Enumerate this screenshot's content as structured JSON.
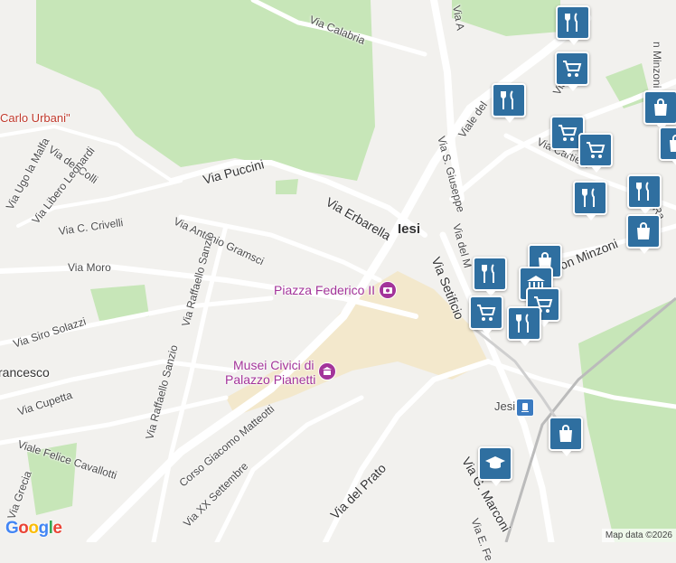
{
  "map": {
    "streets": [
      {
        "id": "via-calabria",
        "text": "Via Calabria"
      },
      {
        "id": "via-s-giuseppe",
        "text": "Via S. Giuseppe"
      },
      {
        "id": "viale-del",
        "text": "Viale del"
      },
      {
        "id": "via-dei-colli",
        "text": "Via dei Colli"
      },
      {
        "id": "via-ugo-la-malfa",
        "text": "Via Ugo la Malfa"
      },
      {
        "id": "via-libero-leonardi",
        "text": "Via Libero Leonardi"
      },
      {
        "id": "via-c-crivelli",
        "text": "Via C. Crivelli"
      },
      {
        "id": "via-puccini",
        "text": "Via Puccini"
      },
      {
        "id": "via-erbarella",
        "text": "Via Erbarella"
      },
      {
        "id": "via-antonio-gramsci",
        "text": "Via Antonio Gramsci"
      },
      {
        "id": "via-raffaello-sanzio-1",
        "text": "Via Raffaello Sanzio"
      },
      {
        "id": "via-moro",
        "text": "Via Moro"
      },
      {
        "id": "via-siro-solazzi",
        "text": "Via Siro Solazzi"
      },
      {
        "id": "francesco",
        "text": "rancesco"
      },
      {
        "id": "via-cupetta",
        "text": "Via Cupetta"
      },
      {
        "id": "via-raffaello-sanzio-2",
        "text": "Via Raffaello Sanzio"
      },
      {
        "id": "viale-felice-cavallotti",
        "text": "Viale Felice Cavallotti"
      },
      {
        "id": "via-grecia",
        "text": "Via Grecia"
      },
      {
        "id": "corso-giacomo-matteotti",
        "text": "Corso Giacomo Matteotti"
      },
      {
        "id": "via-xx-settembre",
        "text": "Via XX Settembre"
      },
      {
        "id": "via-del-prato",
        "text": "Via del Prato"
      },
      {
        "id": "via-setificio",
        "text": "Via Setificio"
      },
      {
        "id": "via-del-m",
        "text": "Via del M"
      },
      {
        "id": "via-g-marconi",
        "text": "Via G. Marconi"
      },
      {
        "id": "via-e-fe",
        "text": "Via E. Fe"
      },
      {
        "id": "via-cartiere",
        "text": "Via Cartiere"
      },
      {
        "id": "via-an",
        "text": "Via An"
      },
      {
        "id": "on-minzoni",
        "text": "on Minzoni"
      },
      {
        "id": "n-minzoni",
        "text": "n Minzoni"
      },
      {
        "id": "via-ra",
        "text": "Via Ra"
      },
      {
        "id": "via-a",
        "text": "Via A"
      }
    ],
    "places": {
      "town": "Iesi",
      "carlo_urbani": "Carlo Urbani\"",
      "piazza": "Piazza Federico II",
      "musei_line1": "Musei Civici di",
      "musei_line2": "Palazzo Pianetti",
      "station": "Jesi"
    },
    "pins": [
      {
        "type": "restaurant"
      },
      {
        "type": "shopping-cart"
      },
      {
        "type": "restaurant"
      },
      {
        "type": "shopping-cart"
      },
      {
        "type": "shopping-cart"
      },
      {
        "type": "shopping-bag"
      },
      {
        "type": "restaurant"
      },
      {
        "type": "restaurant"
      },
      {
        "type": "shopping-bag"
      },
      {
        "type": "shopping-bag"
      },
      {
        "type": "restaurant"
      },
      {
        "type": "shopping-bag"
      },
      {
        "type": "museum"
      },
      {
        "type": "shopping-cart"
      },
      {
        "type": "shopping-cart"
      },
      {
        "type": "restaurant"
      },
      {
        "type": "shopping-bag"
      },
      {
        "type": "school"
      }
    ],
    "colors": {
      "background": "#f2f1ee",
      "park": "#c7e6b8",
      "road": "#ffffff",
      "highway": "#f3e3b5",
      "pin": "#2f6fa0",
      "poi": "#a3349a"
    }
  },
  "branding": {
    "logo": "Google",
    "attribution": "Map data ©2026"
  }
}
